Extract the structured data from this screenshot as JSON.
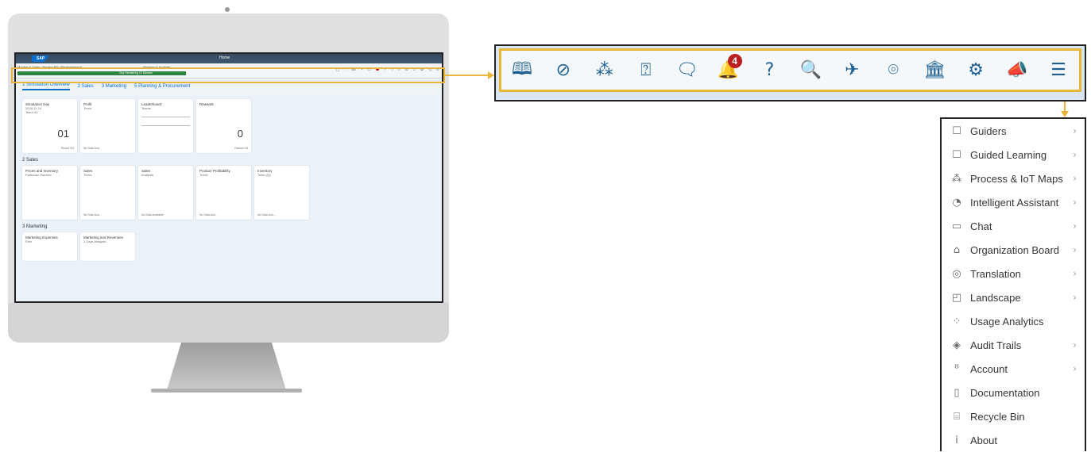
{
  "shell": {
    "logo": "SAP",
    "title": "Home"
  },
  "infobar": {
    "left": "Monitor & Sales | Review P&L Replenishment",
    "middle": "Strategy & Analysis",
    "green": "Day Remaining 12 Minutes"
  },
  "tabs": [
    "1 Simulation Overview",
    "2 Sales",
    "3 Marketing",
    "5 Planning & Procurement"
  ],
  "sections": {
    "s1": {
      "title": "",
      "tiles": [
        {
          "title": "Simulation Day",
          "sub": "2018-11-14",
          "sub2": "Team 03",
          "big": "01",
          "foot": "Round 3/3"
        },
        {
          "title": "Profit",
          "sub": "Trend",
          "foot": "No Data Ava..."
        },
        {
          "title": "Leaderboard",
          "sub": "Teams",
          "foot": ""
        },
        {
          "title": "Rewards",
          "sub": "",
          "big": "0",
          "foot": "Ranked #3"
        }
      ]
    },
    "s2": {
      "title": "2 Sales",
      "tiles": [
        {
          "title": "Prices and Inventory",
          "sub": "Particular Stocked",
          "foot": ""
        },
        {
          "title": "Sales",
          "sub": "Trend",
          "foot": "No Data Ava..."
        },
        {
          "title": "Sales",
          "sub": "Analysis",
          "foot": "No Data Available"
        },
        {
          "title": "Product Profitability",
          "sub": "Trend",
          "foot": "No Data Ava..."
        },
        {
          "title": "Inventory",
          "sub": "Totes (Q)",
          "foot": "No Data Ava..."
        }
      ]
    },
    "s3": {
      "title": "3 Marketing",
      "tiles": [
        {
          "title": "Marketing Expenses",
          "sub": "Plan"
        },
        {
          "title": "Marketing and Revenues",
          "sub": "3 Days Analysis"
        }
      ]
    }
  },
  "toolbar": {
    "icons": [
      "guided-learning-icon",
      "compass-icon",
      "process-maps-icon",
      "intelligent-assistant-icon",
      "chat-icon",
      "bell-icon",
      "help-icon",
      "search-icon",
      "feedback-icon",
      "location-icon",
      "organization-icon",
      "settings-icon",
      "announcement-icon",
      "menu-icon"
    ],
    "glyphs": [
      "🕮",
      "⊘",
      "⁂",
      "⍰",
      "🗨",
      "🔔",
      "?",
      "🔍",
      "✈",
      "⌾",
      "🏛",
      "⚙",
      "📣",
      "☰"
    ],
    "notification_count": "4"
  },
  "menu": {
    "items": [
      {
        "label": "Guiders",
        "icon": "guiders-icon",
        "glyph": "☐",
        "chevron": true
      },
      {
        "label": "Guided Learning",
        "icon": "guided-learning-icon",
        "glyph": "☐",
        "chevron": true
      },
      {
        "label": "Process & IoT Maps",
        "icon": "process-maps-icon",
        "glyph": "⁂",
        "chevron": true
      },
      {
        "label": "Intelligent Assistant",
        "icon": "intelligent-assistant-icon",
        "glyph": "◔",
        "chevron": true
      },
      {
        "label": "Chat",
        "icon": "chat-icon",
        "glyph": "▭",
        "chevron": true
      },
      {
        "label": "Organization Board",
        "icon": "organization-icon",
        "glyph": "⌂",
        "chevron": true
      },
      {
        "label": "Translation",
        "icon": "translation-icon",
        "glyph": "◎",
        "chevron": true
      },
      {
        "label": "Landscape",
        "icon": "landscape-icon",
        "glyph": "◰",
        "chevron": true
      },
      {
        "label": "Usage Analytics",
        "icon": "usage-analytics-icon",
        "glyph": "⁘",
        "chevron": false
      },
      {
        "label": "Audit Trails",
        "icon": "audit-trails-icon",
        "glyph": "◈",
        "chevron": true
      },
      {
        "label": "Account",
        "icon": "account-icon",
        "glyph": "ᴽ",
        "chevron": true
      },
      {
        "label": "Documentation",
        "icon": "documentation-icon",
        "glyph": "▯",
        "chevron": false
      },
      {
        "label": "Recycle Bin",
        "icon": "recycle-bin-icon",
        "glyph": "⌸",
        "chevron": false
      },
      {
        "label": "About",
        "icon": "about-icon",
        "glyph": "i",
        "chevron": false
      }
    ],
    "chevron_glyph": "›"
  },
  "colors": {
    "highlight": "#e8b63a",
    "icon": "#1d5f92",
    "badge": "#bb1f1f"
  }
}
